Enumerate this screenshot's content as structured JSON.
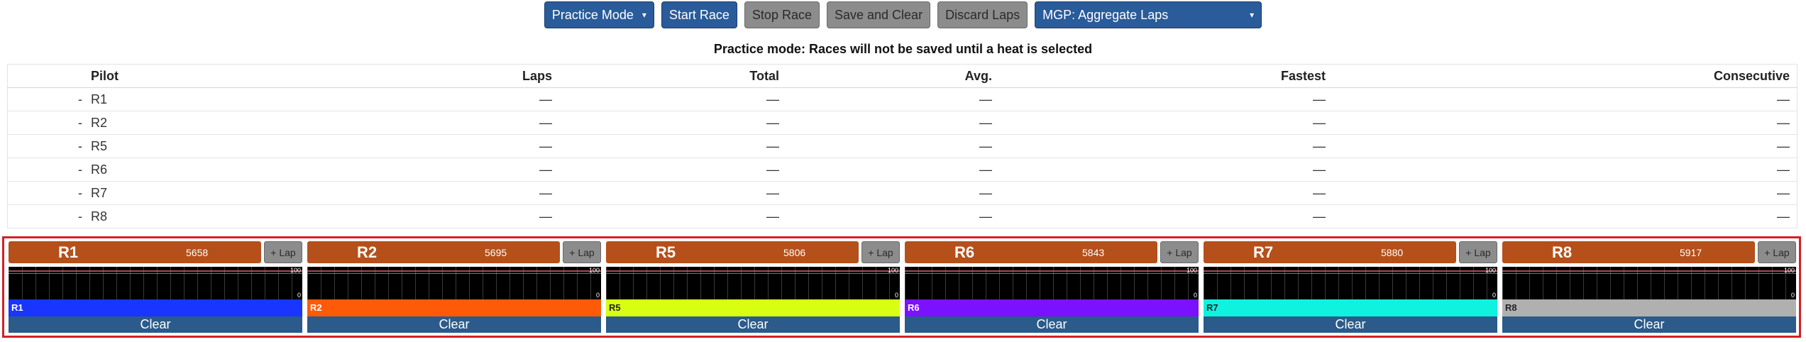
{
  "toolbar": {
    "practice_mode_label": "Practice Mode",
    "start_race_label": "Start Race",
    "stop_race_label": "Stop Race",
    "save_clear_label": "Save and Clear",
    "discard_laps_label": "Discard Laps",
    "race_format_label": "MGP: Aggregate Laps"
  },
  "notice": "Practice mode: Races will not be saved until a heat is selected",
  "leaderboard": {
    "headers": {
      "pilot": "Pilot",
      "laps": "Laps",
      "total": "Total",
      "avg": "Avg.",
      "fastest": "Fastest",
      "consecutive": "Consecutive"
    },
    "rows": [
      {
        "pos": "-",
        "pilot": "R1",
        "laps": "—",
        "total": "—",
        "avg": "—",
        "fastest": "—",
        "consecutive": "—"
      },
      {
        "pos": "-",
        "pilot": "R2",
        "laps": "—",
        "total": "—",
        "avg": "—",
        "fastest": "—",
        "consecutive": "—"
      },
      {
        "pos": "-",
        "pilot": "R5",
        "laps": "—",
        "total": "—",
        "avg": "—",
        "fastest": "—",
        "consecutive": "—"
      },
      {
        "pos": "-",
        "pilot": "R6",
        "laps": "—",
        "total": "—",
        "avg": "—",
        "fastest": "—",
        "consecutive": "—"
      },
      {
        "pos": "-",
        "pilot": "R7",
        "laps": "—",
        "total": "—",
        "avg": "—",
        "fastest": "—",
        "consecutive": "—"
      },
      {
        "pos": "-",
        "pilot": "R8",
        "laps": "—",
        "total": "—",
        "avg": "—",
        "fastest": "—",
        "consecutive": "—"
      }
    ]
  },
  "nodes": [
    {
      "name": "R1",
      "freq": "5658",
      "lap_label": "+ Lap",
      "graph_max": "100",
      "graph_min": "0",
      "pilot_label": "R1",
      "color": "#1a35ff",
      "text_color": "#ffffff",
      "clear_label": "Clear"
    },
    {
      "name": "R2",
      "freq": "5695",
      "lap_label": "+ Lap",
      "graph_max": "100",
      "graph_min": "0",
      "pilot_label": "R2",
      "color": "#ff5a08",
      "text_color": "#ffffff",
      "clear_label": "Clear"
    },
    {
      "name": "R5",
      "freq": "5806",
      "lap_label": "+ Lap",
      "graph_max": "100",
      "graph_min": "0",
      "pilot_label": "R5",
      "color": "#d8ff12",
      "text_color": "#222222",
      "clear_label": "Clear"
    },
    {
      "name": "R6",
      "freq": "5843",
      "lap_label": "+ Lap",
      "graph_max": "100",
      "graph_min": "0",
      "pilot_label": "R6",
      "color": "#7a12ff",
      "text_color": "#ffffff",
      "clear_label": "Clear"
    },
    {
      "name": "R7",
      "freq": "5880",
      "lap_label": "+ Lap",
      "graph_max": "100",
      "graph_min": "0",
      "pilot_label": "R7",
      "color": "#0ff2e0",
      "text_color": "#222222",
      "clear_label": "Clear"
    },
    {
      "name": "R8",
      "freq": "5917",
      "lap_label": "+ Lap",
      "graph_max": "100",
      "graph_min": "0",
      "pilot_label": "R8",
      "color": "#b0b0b0",
      "text_color": "#222222",
      "clear_label": "Clear"
    }
  ],
  "colors": {
    "primary_button": "#2a5b9a",
    "secondary_button": "#8c8c8c",
    "node_header": "#b5501b",
    "clear_button": "#2a5b8a",
    "panel_highlight": "#d42026"
  }
}
